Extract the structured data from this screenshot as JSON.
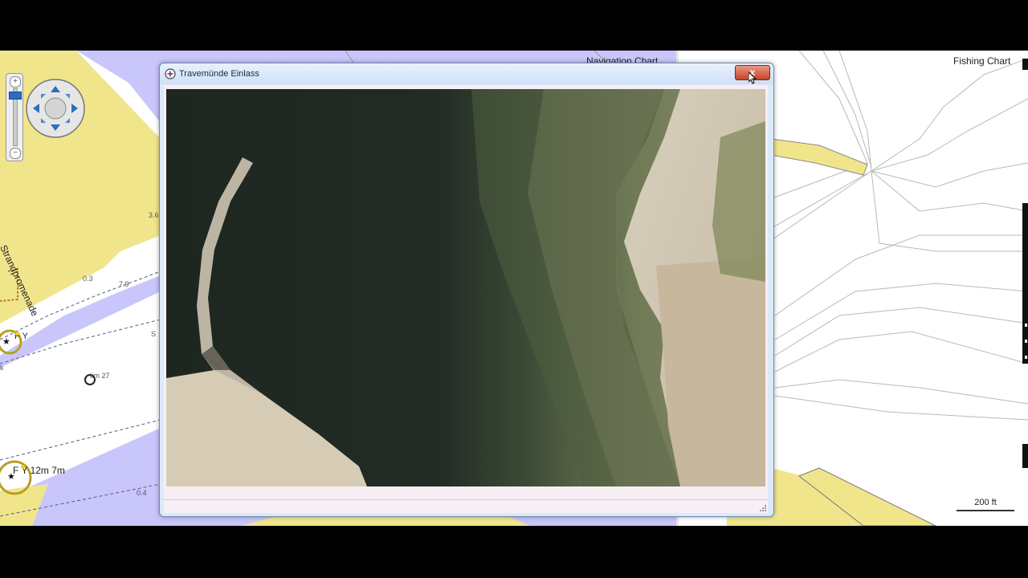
{
  "navigation_chart": {
    "title": "Navigation Chart",
    "labels": {
      "street": "Strandpromenade",
      "buoy_upper": "F Y",
      "buoy_lower": "F Y 12m 7m",
      "km_marker": "km 27",
      "k_label": "k"
    },
    "soundings": [
      "3.6",
      "0.3",
      "7.9",
      "0.4",
      "S"
    ],
    "colors": {
      "land": "#f1e58c",
      "water_shallow": "#c9c6fb",
      "water_deep": "#ffffff"
    }
  },
  "fishing_chart": {
    "title": "Fishing Chart",
    "scale_label": "200 ft",
    "colors": {
      "land": "#f1e58c",
      "contour": "#b8b8b8"
    }
  },
  "dialog": {
    "title": "Travemünde Einlass",
    "close_label": "x",
    "icon": "compass-icon",
    "content": "aerial-photo"
  },
  "controls": {
    "zoom": "zoom-slider",
    "pan": "pan-control"
  }
}
